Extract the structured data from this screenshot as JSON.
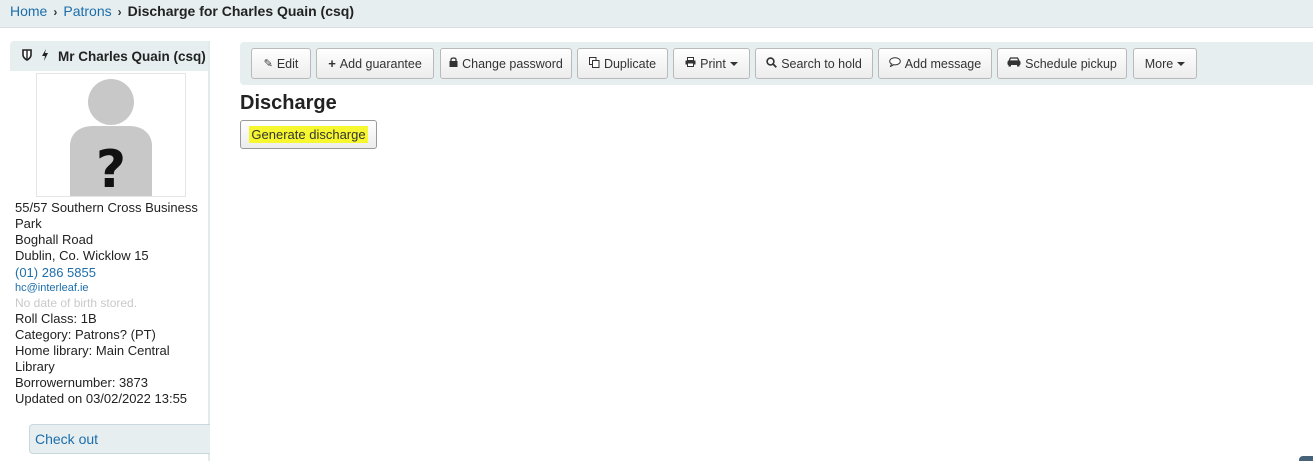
{
  "breadcrumb": {
    "items": [
      "Home",
      "Patrons"
    ],
    "current": "Discharge for Charles Quain (csq)"
  },
  "patron": {
    "name": "Mr Charles Quain (csq)",
    "address_line1": "55/57 Southern Cross Business",
    "address_line2": "Park",
    "address_line3": "Boghall Road",
    "address_line4": "Dublin, Co. Wicklow 15",
    "phone": "(01) 286 5855",
    "email": "hc@interleaf.ie",
    "dob": "No date of birth stored.",
    "roll_class": "Roll Class: 1B",
    "category": "Category: Patrons? (PT)",
    "home_library_1": "Home library: Main Central",
    "home_library_2": "Library",
    "borrowernumber": "Borrowernumber: 3873",
    "updated": "Updated on 03/02/2022 13:55",
    "photo_glyph": "?"
  },
  "sidebar": {
    "checkout": "Check out"
  },
  "toolbar": {
    "edit": "Edit",
    "add_guarantee": "Add guarantee",
    "change_password": "Change password",
    "duplicate": "Duplicate",
    "print": "Print",
    "search_to_hold": "Search to hold",
    "add_message": "Add message",
    "schedule_pickup": "Schedule pickup",
    "more": "More"
  },
  "main": {
    "title": "Discharge",
    "generate_button": "Generate discharge"
  },
  "colors": {
    "link": "#1c6eaa",
    "panel": "#e6eef0",
    "highlight": "#f7f730"
  }
}
